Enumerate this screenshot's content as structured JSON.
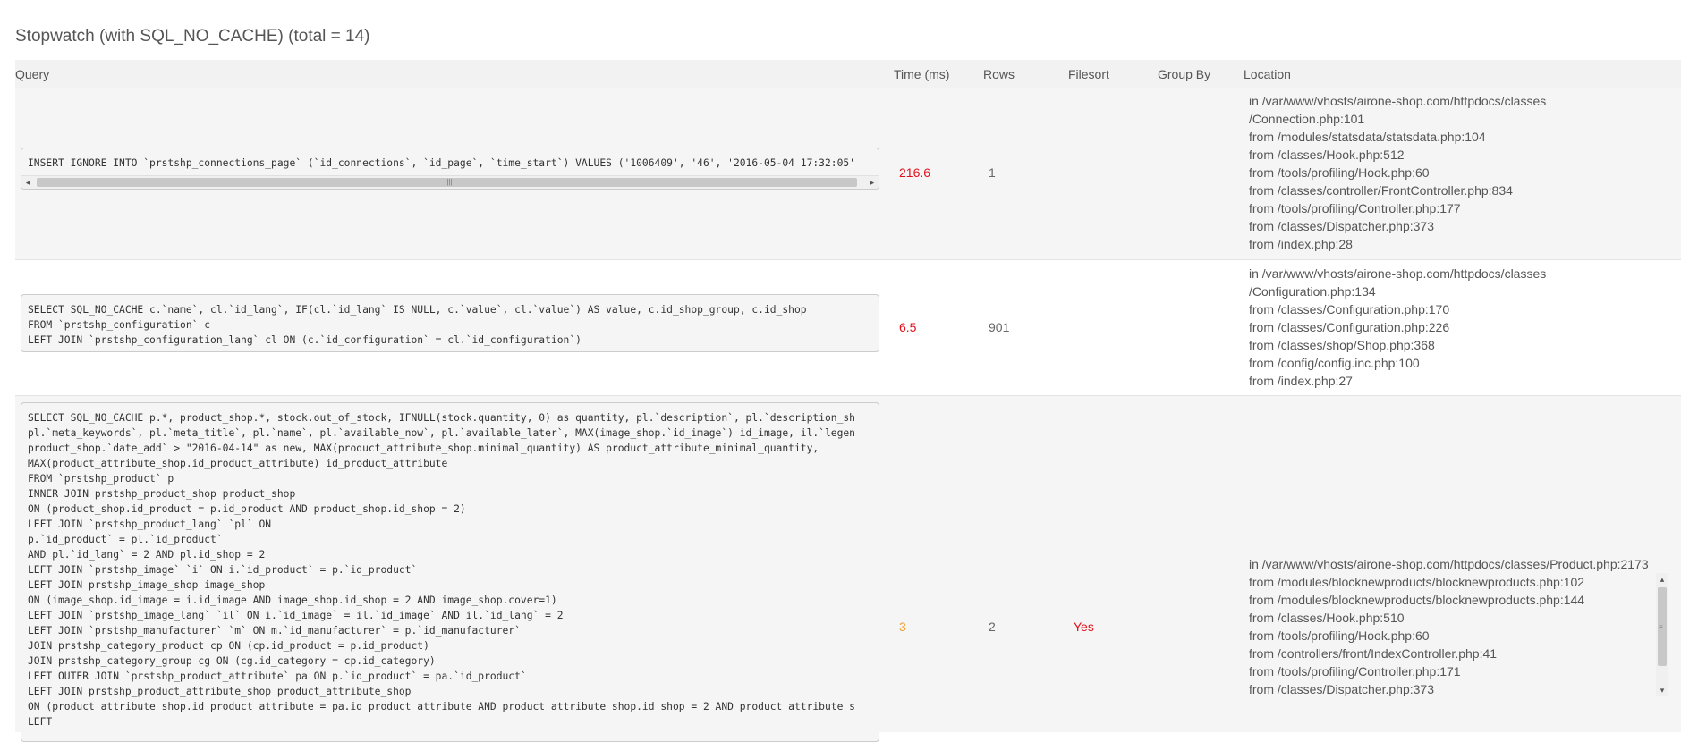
{
  "title": "Stopwatch (with SQL_NO_CACHE) (total = 14)",
  "columns": {
    "query": "Query",
    "time": "Time (ms)",
    "rows": "Rows",
    "filesort": "Filesort",
    "group_by": "Group By",
    "location": "Location"
  },
  "rows": [
    {
      "query": "INSERT IGNORE INTO `prstshp_connections_page` (`id_connections`, `id_page`, `time_start`) VALUES ('1006409', '46', '2016-05-04 17:32:05'",
      "time": "216.6",
      "rows": "1",
      "filesort": "",
      "group_by": "",
      "location": [
        "in /var/www/vhosts/airone-shop.com/httpdocs/classes",
        "/Connection.php:101",
        "from /modules/statsdata/statsdata.php:104",
        "from /classes/Hook.php:512",
        "from /tools/profiling/Hook.php:60",
        "from /classes/controller/FrontController.php:834",
        "from /tools/profiling/Controller.php:177",
        "from /classes/Dispatcher.php:373",
        "from /index.php:28"
      ]
    },
    {
      "query": "SELECT SQL_NO_CACHE c.`name`, cl.`id_lang`, IF(cl.`id_lang` IS NULL, c.`value`, cl.`value`) AS value, c.id_shop_group, c.id_shop\nFROM `prstshp_configuration` c\nLEFT JOIN `prstshp_configuration_lang` cl ON (c.`id_configuration` = cl.`id_configuration`)",
      "time": "6.5",
      "rows": "901",
      "filesort": "",
      "group_by": "",
      "location": [
        "in /var/www/vhosts/airone-shop.com/httpdocs/classes",
        "/Configuration.php:134",
        "from /classes/Configuration.php:170",
        "from /classes/Configuration.php:226",
        "from /classes/shop/Shop.php:368",
        "from /config/config.inc.php:100",
        "from /index.php:27"
      ]
    },
    {
      "query": "SELECT SQL_NO_CACHE p.*, product_shop.*, stock.out_of_stock, IFNULL(stock.quantity, 0) as quantity, pl.`description`, pl.`description_sh\npl.`meta_keywords`, pl.`meta_title`, pl.`name`, pl.`available_now`, pl.`available_later`, MAX(image_shop.`id_image`) id_image, il.`legen\nproduct_shop.`date_add` > \"2016-04-14\" as new, MAX(product_attribute_shop.minimal_quantity) AS product_attribute_minimal_quantity,\nMAX(product_attribute_shop.id_product_attribute) id_product_attribute\nFROM `prstshp_product` p\nINNER JOIN prstshp_product_shop product_shop\nON (product_shop.id_product = p.id_product AND product_shop.id_shop = 2)\nLEFT JOIN `prstshp_product_lang` `pl` ON\np.`id_product` = pl.`id_product`\nAND pl.`id_lang` = 2 AND pl.id_shop = 2\nLEFT JOIN `prstshp_image` `i` ON i.`id_product` = p.`id_product`\nLEFT JOIN prstshp_image_shop image_shop\nON (image_shop.id_image = i.id_image AND image_shop.id_shop = 2 AND image_shop.cover=1)\nLEFT JOIN `prstshp_image_lang` `il` ON i.`id_image` = il.`id_image` AND il.`id_lang` = 2\nLEFT JOIN `prstshp_manufacturer` `m` ON m.`id_manufacturer` = p.`id_manufacturer`\nJOIN prstshp_category_product cp ON (cp.id_product = p.id_product)\nJOIN prstshp_category_group cg ON (cg.id_category = cp.id_category)\nLEFT OUTER JOIN `prstshp_product_attribute` pa ON p.`id_product` = pa.`id_product`\nLEFT JOIN prstshp_product_attribute_shop product_attribute_shop\nON (product_attribute_shop.id_product_attribute = pa.id_product_attribute AND product_attribute_shop.id_shop = 2 AND product_attribute_s\nLEFT",
      "time": "3",
      "rows": "2",
      "filesort": "Yes",
      "group_by": "",
      "location": [
        "in /var/www/vhosts/airone-shop.com/httpdocs/classes/Product.php:2173",
        "from /modules/blocknewproducts/blocknewproducts.php:102",
        "from /modules/blocknewproducts/blocknewproducts.php:144",
        "from /classes/Hook.php:510",
        "from /tools/profiling/Hook.php:60",
        "from /controllers/front/IndexController.php:41",
        "from /tools/profiling/Controller.php:171",
        "from /classes/Dispatcher.php:373"
      ]
    }
  ],
  "colors": {
    "time_high": "#e2101c",
    "time_medium": "#f0a030",
    "filesort_yes": "#e2101c"
  }
}
